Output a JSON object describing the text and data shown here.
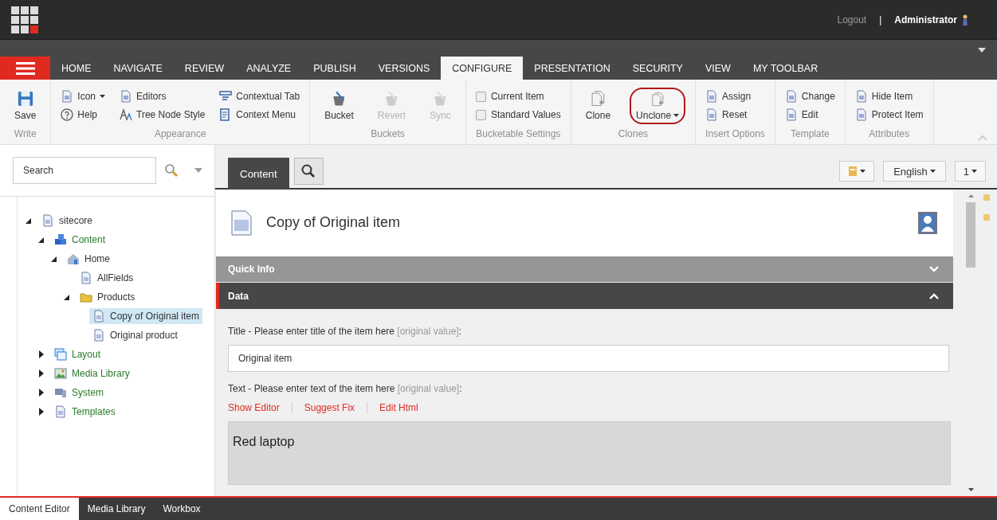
{
  "header": {
    "logout": "Logout",
    "separator": "|",
    "user": "Administrator"
  },
  "menu_tabs": [
    {
      "label": "HOME",
      "selected": false
    },
    {
      "label": "NAVIGATE",
      "selected": false
    },
    {
      "label": "REVIEW",
      "selected": false
    },
    {
      "label": "ANALYZE",
      "selected": false
    },
    {
      "label": "PUBLISH",
      "selected": false
    },
    {
      "label": "VERSIONS",
      "selected": false
    },
    {
      "label": "CONFIGURE",
      "selected": true
    },
    {
      "label": "PRESENTATION",
      "selected": false
    },
    {
      "label": "SECURITY",
      "selected": false
    },
    {
      "label": "VIEW",
      "selected": false
    },
    {
      "label": "MY TOOLBAR",
      "selected": false
    }
  ],
  "ribbon": [
    {
      "title": "Write",
      "items": [
        {
          "label": "Save",
          "kind": "large",
          "disabled": false
        }
      ]
    },
    {
      "title": "Appearance",
      "items": [
        {
          "label": "Icon",
          "kind": "small",
          "disabled": false,
          "dropdown": true
        },
        {
          "label": "Help",
          "kind": "small",
          "disabled": false
        },
        {
          "label": "Editors",
          "kind": "small",
          "disabled": false
        },
        {
          "label": "Tree Node Style",
          "kind": "small",
          "disabled": false
        },
        {
          "label": "Contextual Tab",
          "kind": "small",
          "disabled": false
        },
        {
          "label": "Context Menu",
          "kind": "small",
          "disabled": false
        }
      ]
    },
    {
      "title": "Buckets",
      "items": [
        {
          "label": "Bucket",
          "kind": "large",
          "disabled": false
        },
        {
          "label": "Revert",
          "kind": "large",
          "disabled": true
        },
        {
          "label": "Sync",
          "kind": "large",
          "disabled": true
        }
      ]
    },
    {
      "title": "Bucketable Settings",
      "items": [
        {
          "label": "Current Item",
          "kind": "checkbox",
          "checked": false
        },
        {
          "label": "Standard Values",
          "kind": "checkbox",
          "checked": false
        }
      ]
    },
    {
      "title": "Clones",
      "items": [
        {
          "label": "Clone",
          "kind": "large",
          "disabled": false
        },
        {
          "label": "Unclone",
          "kind": "large",
          "disabled": false,
          "dropdown": true,
          "highlighted": true
        }
      ]
    },
    {
      "title": "Insert Options",
      "items": [
        {
          "label": "Assign",
          "kind": "small",
          "disabled": false
        },
        {
          "label": "Reset",
          "kind": "small",
          "disabled": false
        }
      ]
    },
    {
      "title": "Template",
      "items": [
        {
          "label": "Change",
          "kind": "small",
          "disabled": false
        },
        {
          "label": "Edit",
          "kind": "small",
          "disabled": false
        }
      ]
    },
    {
      "title": "Attributes",
      "items": [
        {
          "label": "Hide Item",
          "kind": "small",
          "disabled": false
        },
        {
          "label": "Protect Item",
          "kind": "small",
          "disabled": false
        }
      ]
    }
  ],
  "search": {
    "placeholder": "Search"
  },
  "tree": [
    {
      "label": "sitecore",
      "color": "#333333",
      "expanded": true,
      "selected": false,
      "children": [
        {
          "label": "Content",
          "color": "#2b7a2b",
          "expanded": true,
          "selected": false,
          "children": [
            {
              "label": "Home",
              "color": "#333333",
              "expanded": true,
              "selected": false,
              "children": [
                {
                  "label": "AllFields",
                  "color": "#333333",
                  "selected": false
                },
                {
                  "label": "Products",
                  "color": "#333333",
                  "expanded": true,
                  "selected": false,
                  "children": [
                    {
                      "label": "Copy of Original item",
                      "color": "#333333",
                      "selected": true
                    },
                    {
                      "label": "Original product",
                      "color": "#333333",
                      "selected": false
                    }
                  ]
                }
              ]
            }
          ]
        },
        {
          "label": "Layout",
          "color": "#2b7a2b",
          "expanded": false,
          "selected": false
        },
        {
          "label": "Media Library",
          "color": "#2b7a2b",
          "expanded": false,
          "selected": false
        },
        {
          "label": "System",
          "color": "#2b7a2b",
          "expanded": false,
          "selected": false
        },
        {
          "label": "Templates",
          "color": "#2b7a2b",
          "expanded": false,
          "selected": false
        }
      ]
    }
  ],
  "editor_tabs": [
    {
      "label": "Content",
      "selected": true
    }
  ],
  "language": "English",
  "version": "1",
  "item_title": "Copy of Original item",
  "sections": [
    {
      "title": "Quick Info",
      "expanded": false
    },
    {
      "title": "Data",
      "expanded": true,
      "fields": [
        {
          "kind": "text",
          "label": "Title - Please enter title of the item here",
          "source": "[original value]",
          "label_end": ":",
          "value": "Original item"
        },
        {
          "kind": "rich",
          "label": "Text - Please enter text of the item here",
          "source": "[original value]",
          "label_end": ":",
          "links": [
            "Show Editor",
            "Suggest Fix",
            "Edit Html"
          ],
          "value": "Red laptop"
        }
      ]
    }
  ],
  "bottom_tabs": [
    {
      "label": "Content Editor",
      "selected": true
    },
    {
      "label": "Media Library",
      "selected": false
    },
    {
      "label": "Workbox",
      "selected": false
    }
  ]
}
